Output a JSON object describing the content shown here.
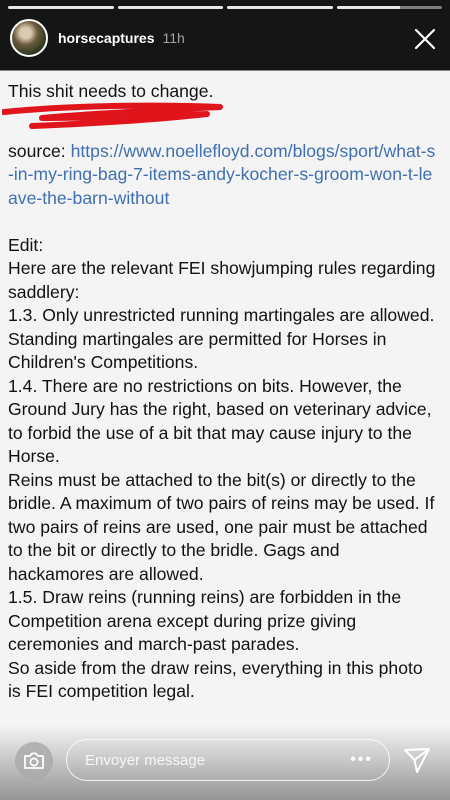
{
  "header": {
    "username": "horsecaptures",
    "time": "11h"
  },
  "progress": {
    "segments": 4,
    "active_index": 3,
    "active_fraction": 0.6
  },
  "post": {
    "title": "This shit needs to change.",
    "source_label": "source: ",
    "source_url": "https://www.noellefloyd.com/blogs/sport/what-s-in-my-ring-bag-7-items-andy-kocher-s-groom-won-t-leave-the-barn-without",
    "edit_heading": "Edit:",
    "intro": "Here are the relevant FEI showjumping rules regarding saddlery:",
    "rules": [
      "1.3. Only unrestricted running martingales are allowed. Standing martingales are permitted for Horses in Children's Competitions.",
      "1.4. There are no restrictions on bits. However, the Ground Jury has the right, based on veterinary advice, to forbid the use of a bit that may cause injury to the Horse.",
      "Reins must be attached to the bit(s) or directly to the bridle. A maximum of two pairs of reins may be used. If two pairs of reins are used, one pair must be attached to the bit or directly to the bridle. Gags and hackamores are allowed.",
      "1.5. Draw reins (running reins) are forbidden in the Competition arena except during prize giving ceremonies and march-past parades."
    ],
    "conclusion": "So aside from the draw reins, everything in this photo is FEI competition legal."
  },
  "footer": {
    "message_placeholder": "Envoyer message",
    "more_label": "•••"
  },
  "colors": {
    "link": "#3f6fb0",
    "scribble": "#e0141b",
    "text": "#111111"
  },
  "icons": [
    "avatar",
    "close-icon",
    "camera-icon",
    "more-icon",
    "send-icon"
  ]
}
